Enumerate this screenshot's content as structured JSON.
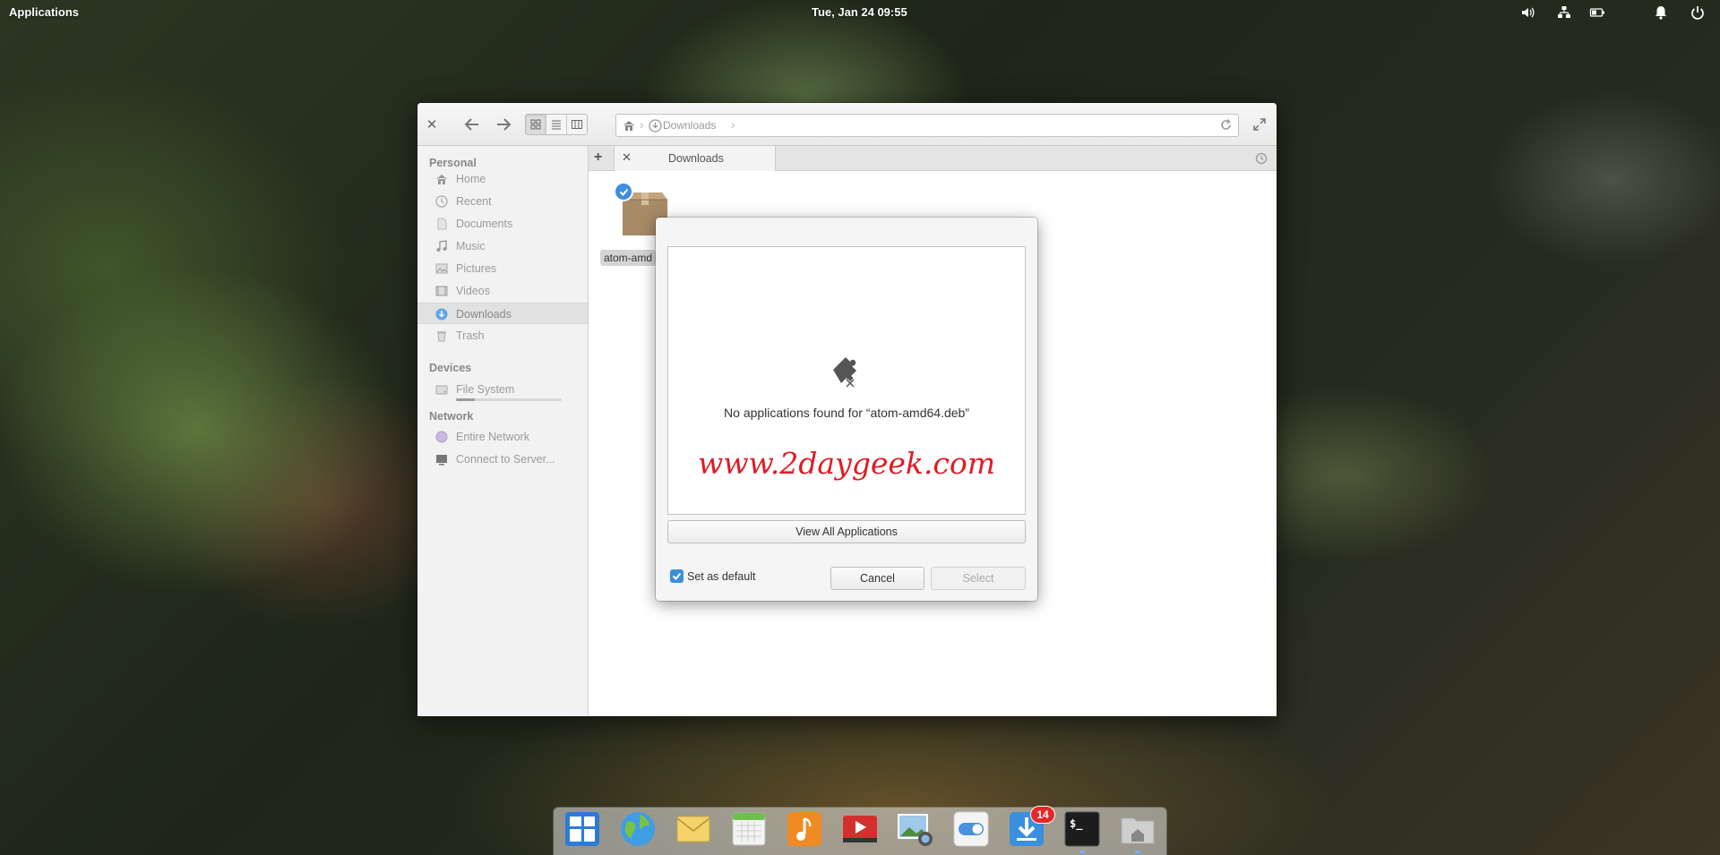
{
  "top_panel": {
    "applications_label": "Applications",
    "clock": "Tue, Jan 24   09:55",
    "indicators": [
      "volume-icon",
      "network-icon",
      "battery-icon",
      "notification-icon",
      "power-icon"
    ]
  },
  "file_manager": {
    "view_modes": [
      "grid",
      "list",
      "columns"
    ],
    "active_view": "grid",
    "path": {
      "home_icon": "home-icon",
      "current": "Downloads"
    },
    "sidebar": {
      "personal_heading": "Personal",
      "personal_items": [
        {
          "label": "Home",
          "icon": "home-icon"
        },
        {
          "label": "Recent",
          "icon": "recent-icon"
        },
        {
          "label": "Documents",
          "icon": "documents-icon"
        },
        {
          "label": "Music",
          "icon": "music-icon"
        },
        {
          "label": "Pictures",
          "icon": "pictures-icon"
        },
        {
          "label": "Videos",
          "icon": "videos-icon"
        },
        {
          "label": "Downloads",
          "icon": "downloads-icon",
          "active": true
        },
        {
          "label": "Trash",
          "icon": "trash-icon"
        }
      ],
      "devices_heading": "Devices",
      "devices_items": [
        {
          "label": "File System",
          "icon": "drive-icon"
        }
      ],
      "network_heading": "Network",
      "network_items": [
        {
          "label": "Entire Network",
          "icon": "network-globe-icon"
        },
        {
          "label": "Connect to Server...",
          "icon": "server-icon"
        }
      ]
    },
    "tabs": [
      {
        "title": "Downloads"
      }
    ],
    "files": [
      {
        "name": "atom-amd",
        "icon": "package-icon",
        "selected": true
      }
    ]
  },
  "dialog": {
    "message": "No applications found for “atom-amd64.deb”",
    "watermark": "www.2daygeek.com",
    "view_all_label": "View All Applications",
    "set_default_label": "Set as default",
    "set_default_checked": true,
    "cancel_label": "Cancel",
    "select_label": "Select"
  },
  "dock": {
    "apps": [
      {
        "name": "multitasking-view"
      },
      {
        "name": "web-browser"
      },
      {
        "name": "mail"
      },
      {
        "name": "calendar"
      },
      {
        "name": "music"
      },
      {
        "name": "videos"
      },
      {
        "name": "photos"
      },
      {
        "name": "system-settings"
      },
      {
        "name": "appcenter",
        "badge": "14"
      },
      {
        "name": "terminal"
      },
      {
        "name": "files"
      }
    ]
  }
}
